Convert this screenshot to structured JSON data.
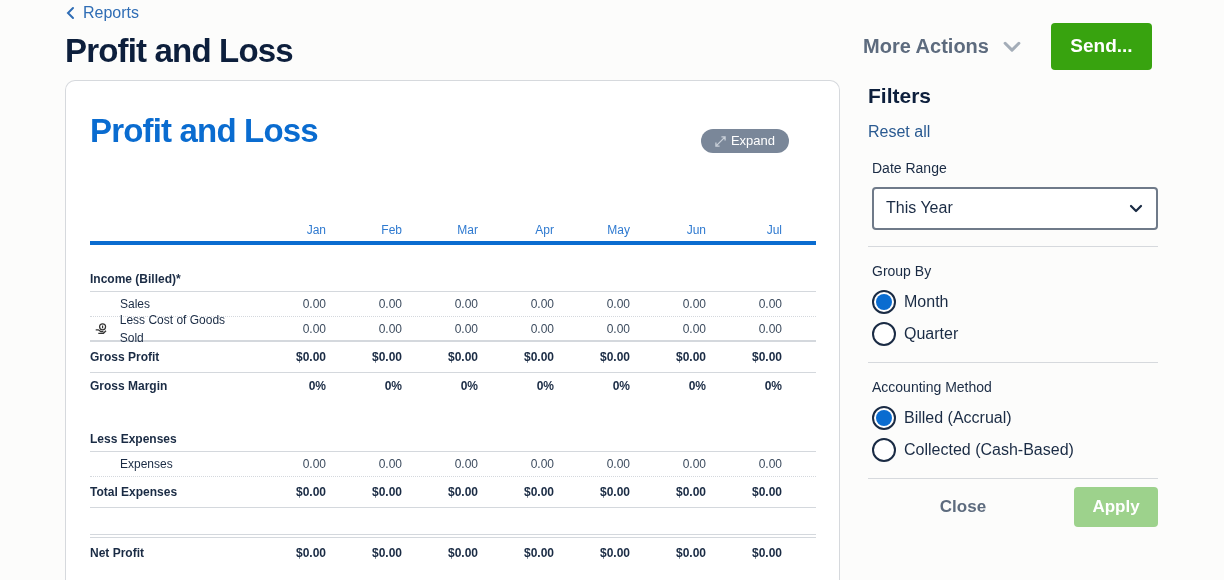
{
  "breadcrumb": "Reports",
  "page_title": "Profit and Loss",
  "more_actions": "More Actions",
  "send_button": "Send...",
  "report": {
    "title": "Profit and Loss",
    "expand_button": "Expand",
    "columns": [
      "Jan",
      "Feb",
      "Mar",
      "Apr",
      "May",
      "Jun",
      "Jul"
    ],
    "rows": [
      {
        "kind": "section",
        "label": "Income (Billed)*",
        "values": []
      },
      {
        "kind": "item",
        "label": "Sales",
        "values": [
          "0.00",
          "0.00",
          "0.00",
          "0.00",
          "0.00",
          "0.00",
          "0.00"
        ]
      },
      {
        "kind": "flagged-item",
        "label": "Less Cost of Goods Sold",
        "values": [
          "0.00",
          "0.00",
          "0.00",
          "0.00",
          "0.00",
          "0.00",
          "0.00"
        ]
      },
      {
        "kind": "total",
        "label": "Gross Profit",
        "values": [
          "$0.00",
          "$0.00",
          "$0.00",
          "$0.00",
          "$0.00",
          "$0.00",
          "$0.00"
        ]
      },
      {
        "kind": "margin",
        "label": "Gross Margin",
        "values": [
          "0%",
          "0%",
          "0%",
          "0%",
          "0%",
          "0%",
          "0%"
        ]
      },
      {
        "kind": "section",
        "label": "Less Expenses",
        "values": []
      },
      {
        "kind": "item",
        "label": "Expenses",
        "values": [
          "0.00",
          "0.00",
          "0.00",
          "0.00",
          "0.00",
          "0.00",
          "0.00"
        ]
      },
      {
        "kind": "total",
        "label": "Total Expenses",
        "values": [
          "$0.00",
          "$0.00",
          "$0.00",
          "$0.00",
          "$0.00",
          "$0.00",
          "$0.00"
        ]
      },
      {
        "kind": "net",
        "label": "Net Profit",
        "values": [
          "$0.00",
          "$0.00",
          "$0.00",
          "$0.00",
          "$0.00",
          "$0.00",
          "$0.00"
        ]
      }
    ]
  },
  "filters": {
    "title": "Filters",
    "reset": "Reset all",
    "date_range": {
      "label": "Date Range",
      "value": "This Year"
    },
    "groups": [
      {
        "label": "Group By",
        "options": [
          {
            "label": "Month",
            "selected": true
          },
          {
            "label": "Quarter",
            "selected": false
          }
        ]
      },
      {
        "label": "Accounting Method",
        "options": [
          {
            "label": "Billed (Accrual)",
            "selected": true
          },
          {
            "label": "Collected (Cash-Based)",
            "selected": false
          }
        ]
      }
    ],
    "close_button": "Close",
    "apply_button": {
      "label": "Apply",
      "disabled": true
    }
  }
}
